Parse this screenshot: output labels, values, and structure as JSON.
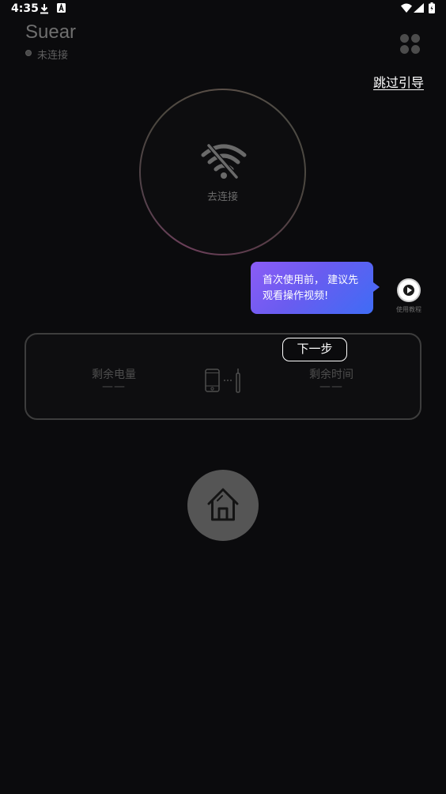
{
  "status_bar": {
    "time": "4:35",
    "left_icons": [
      "download-icon",
      "accessibility-a-icon"
    ],
    "right_icons": [
      "wifi-signal-icon",
      "cell-signal-icon",
      "battery-icon"
    ]
  },
  "header": {
    "title": "Suear",
    "connection_status": "未连接",
    "menu_icon": "four-dots-icon"
  },
  "skip_link": "跳过引导",
  "connect": {
    "icon": "wifi-off-icon",
    "label": "去连接"
  },
  "tooltip": {
    "line1": "首次使用前， 建议先",
    "line2": "观看操作视频!"
  },
  "tutorial": {
    "icon": "play-circle-icon",
    "label": "使用教程"
  },
  "info_card": {
    "next_button": "下一步",
    "battery_label": "剩余电量",
    "battery_value": "——",
    "time_label": "剩余时间",
    "time_value": "——",
    "device_icon": "phone-earpick-link-icon"
  },
  "home": {
    "icon": "home-icon"
  },
  "colors": {
    "background": "#0b0b0d",
    "tooltip_gradient_start": "#8b5cf6",
    "tooltip_gradient_end": "#3f6cf5",
    "home_button": "#555555",
    "muted_text": "#4e4e4e"
  }
}
